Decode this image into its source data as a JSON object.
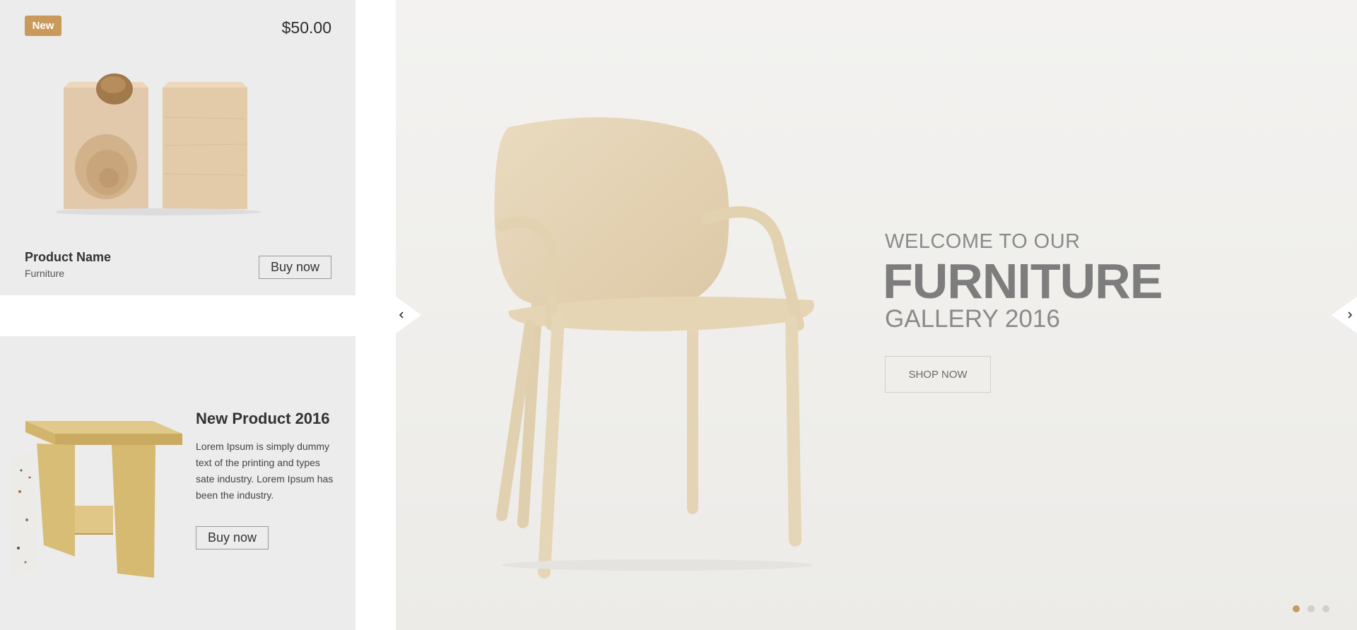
{
  "product_card": {
    "badge": "New",
    "price": "$50.00",
    "name": "Product Name",
    "category": "Furniture",
    "buy_label": "Buy now"
  },
  "promo_card": {
    "title": "New Product 2016",
    "description": "Lorem Ipsum is simply dummy text of the printing and types sate industry. Lorem Ipsum has been the industry.",
    "buy_label": "Buy now"
  },
  "hero": {
    "welcome": "WELCOME TO OUR",
    "headline": "FURNITURE",
    "subheadline": "GALLERY 2016",
    "cta_label": "SHOP NOW",
    "active_slide": 1,
    "slide_count": 3
  },
  "colors": {
    "accent": "#c99a5b",
    "panel_bg": "#ececec",
    "hero_bg": "#f1f0ed",
    "headline_text": "#7d7d7d"
  },
  "icons": {
    "prev": "chevron-left-icon",
    "next": "chevron-right-icon"
  }
}
